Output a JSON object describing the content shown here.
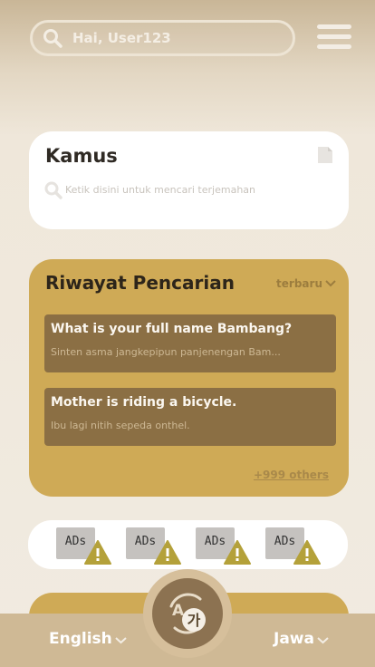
{
  "header": {
    "search_placeholder": "Hai, User123",
    "icons": {
      "search": "search-icon",
      "menu": "hamburger-menu-icon"
    }
  },
  "kamus": {
    "title": "Kamus",
    "search_placeholder": "Ketik disini untuk mencari terjemahan",
    "icons": {
      "document": "document-icon",
      "search": "search-icon"
    }
  },
  "history": {
    "title": "Riwayat Pencarian",
    "sort_label": "terbaru",
    "items": [
      {
        "source": "What is your full name  Bambang?",
        "translation": "Sinten asma jangkepipun panjenengan Bam..."
      },
      {
        "source": "Mother is riding a bicycle.",
        "translation": "Ibu lagi nitih sepeda onthel."
      }
    ],
    "more_label": "+999 others"
  },
  "ads": [
    {
      "label": "ADs",
      "icon": "warning-icon"
    },
    {
      "label": "ADs",
      "icon": "warning-icon"
    },
    {
      "label": "ADs",
      "icon": "warning-icon"
    },
    {
      "label": "ADs",
      "icon": "warning-icon"
    }
  ],
  "bottom_bar": {
    "source_language": "English",
    "target_language": "Jawa",
    "swap_icon": "translate-swap-icon",
    "swap_glyph": "가"
  },
  "colors": {
    "card_gold": "#cfaa56",
    "item_brown": "#8b6f44",
    "bottom_bar": "#cfb995",
    "swap_button": "#8c7251",
    "warning_yellow": "#b4a13a"
  }
}
